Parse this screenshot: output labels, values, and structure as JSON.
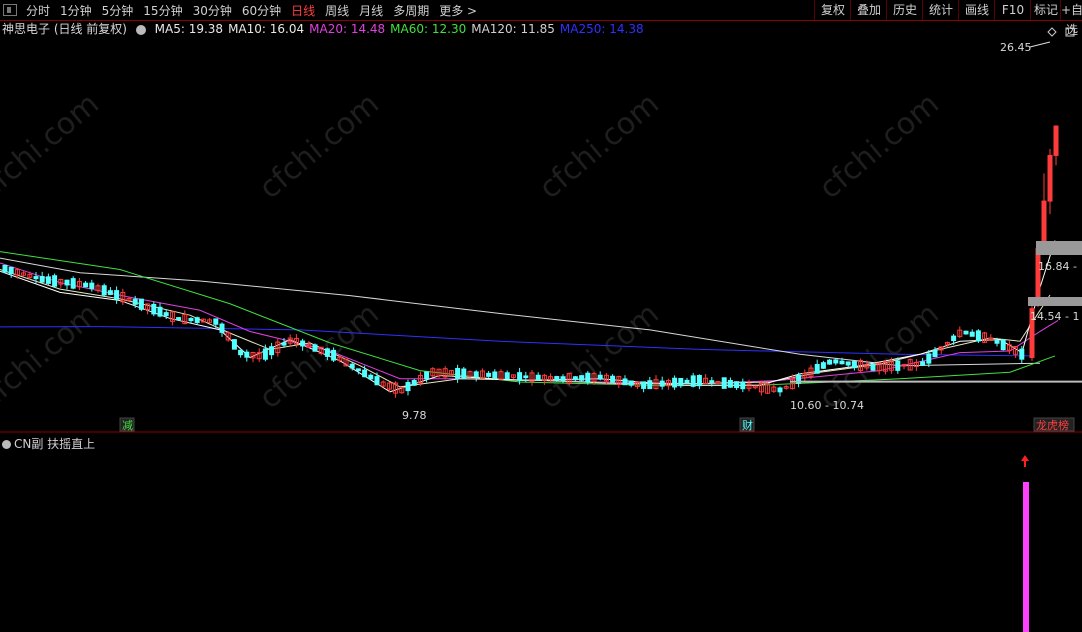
{
  "toolbar": {
    "periods": [
      "分时",
      "1分钟",
      "5分钟",
      "15分钟",
      "30分钟",
      "60分钟",
      "日线",
      "周线",
      "月线",
      "多周期",
      "更多 >"
    ],
    "active_period": "日线",
    "tools": [
      "复权",
      "叠加",
      "历史",
      "统计",
      "画线",
      "F10",
      "标记",
      "+自选"
    ]
  },
  "header": {
    "title": "神思电子 (日线 前复权)",
    "ma": [
      {
        "label": "MA5: 19.38",
        "color": "#e8e8e8"
      },
      {
        "label": "MA10: 16.04",
        "color": "#e8e8e0"
      },
      {
        "label": "MA20: 14.48",
        "color": "#e040e0"
      },
      {
        "label": "MA60: 12.30",
        "color": "#40e040"
      },
      {
        "label": "MA120: 11.85",
        "color": "#d0d0d0"
      },
      {
        "label": "MA250: 14.38",
        "color": "#3030ff"
      }
    ]
  },
  "annotations": {
    "high_price": "26.45",
    "low_price": "9.78",
    "range_label": "10.60 - 10.74",
    "level_1": "16.84 -",
    "level_2": "14.54 - 1",
    "badges": [
      "减",
      "财",
      "龙虎榜"
    ]
  },
  "subchart": {
    "label": "CN副 扶摇直上"
  },
  "watermark": "cfchi.com",
  "colors": {
    "up": "#ff3b3b",
    "down": "#54ffff",
    "border": "#8b0000"
  }
}
